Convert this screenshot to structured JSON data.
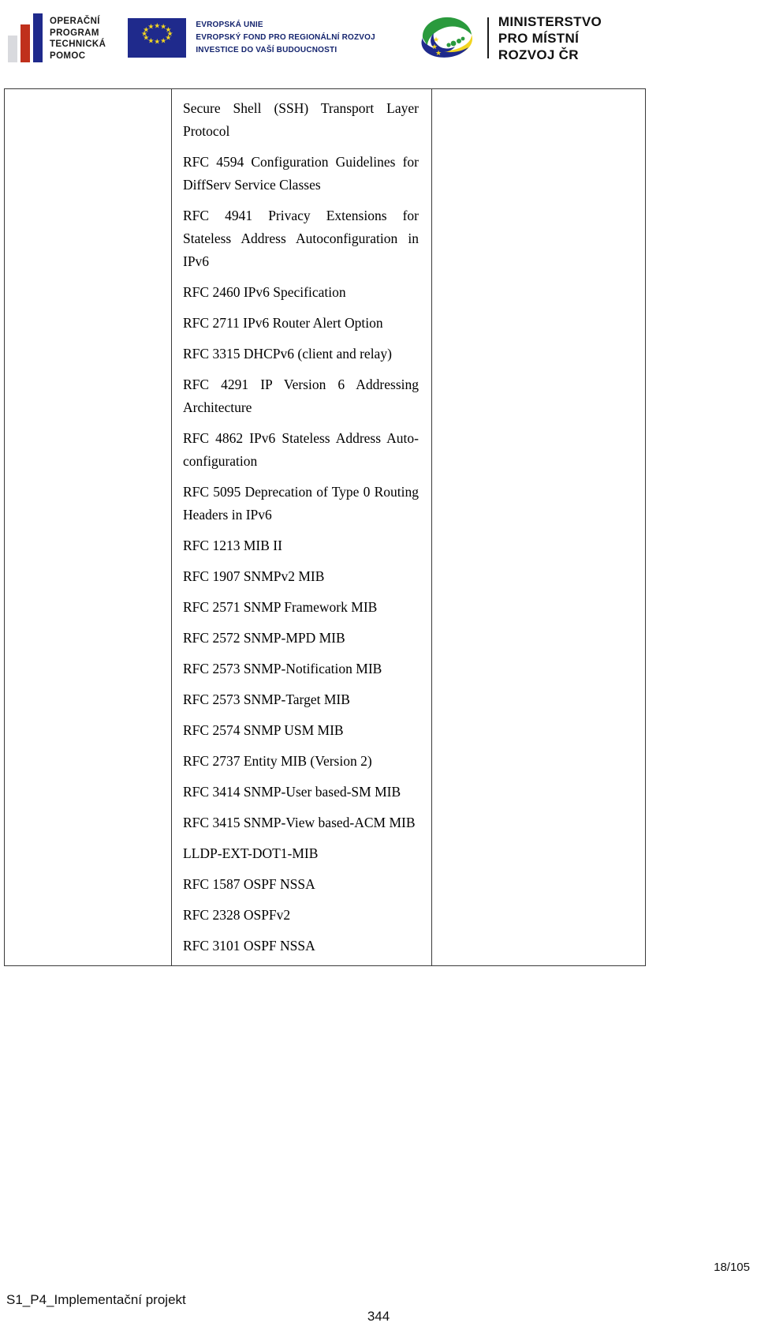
{
  "header": {
    "optp_logo": {
      "icon": "bar-chart-logo",
      "lines": [
        "OPERAČNÍ",
        "PROGRAM",
        "TECHNICKÁ",
        "POMOC"
      ],
      "colors": {
        "gray": "#d9dade",
        "red": "#c0301c",
        "blue": "#1f2a8c"
      }
    },
    "eu_logo": {
      "icon": "eu-flag-icon",
      "flag_color": "#1f2a8c",
      "star_color": "#f2d521",
      "lines": [
        "EVROPSKÁ UNIE",
        "EVROPSKÝ FOND PRO REGIONÁLNÍ ROZVOJ",
        "INVESTICE DO VAŠÍ BUDOUCNOSTI"
      ]
    },
    "mmr_logo": {
      "icon": "mmr-swirl-icon",
      "colors": {
        "green": "#2a9a3d",
        "yellow": "#f2d521",
        "blue": "#1f2a8c"
      },
      "lines": [
        "MINISTERSTVO",
        "PRO MÍSTNÍ",
        "ROZVOJ ČR"
      ]
    }
  },
  "table": {
    "left_column_items": [],
    "middle_column_items": [
      "Secure Shell (SSH) Transport Layer Protocol",
      "RFC 4594 Configuration Guidelines for DiffServ Service Classes",
      "RFC 4941 Privacy Extensions for Stateless Address Autoconfiguration in IPv6",
      "RFC 2460 IPv6 Specification",
      "RFC 2711 IPv6 Router Alert Option",
      "RFC 3315 DHCPv6 (client and relay)",
      "RFC 4291 IP Version 6 Addressing Architecture",
      "RFC 4862 IPv6 Stateless Address Auto-configuration",
      "RFC 5095 Deprecation of Type 0 Routing Headers in IPv6",
      "RFC 1213 MIB II",
      "RFC 1907 SNMPv2 MIB",
      "RFC 2571 SNMP Framework MIB",
      "RFC 2572 SNMP-MPD MIB",
      "RFC 2573 SNMP-Notification MIB",
      "RFC 2573 SNMP-Target MIB",
      "RFC 2574 SNMP USM MIB",
      "RFC 2737 Entity MIB (Version 2)",
      "RFC 3414 SNMP-User based-SM MIB",
      "RFC 3415 SNMP-View based-ACM MIB",
      "LLDP-EXT-DOT1-MIB",
      "RFC 1587 OSPF NSSA",
      "RFC 2328 OSPFv2",
      "RFC 3101 OSPF NSSA"
    ],
    "right_column_items": []
  },
  "footer": {
    "document_name": "S1_P4_Implementační projekt",
    "page_number": "344",
    "page_reference": "18/105"
  }
}
